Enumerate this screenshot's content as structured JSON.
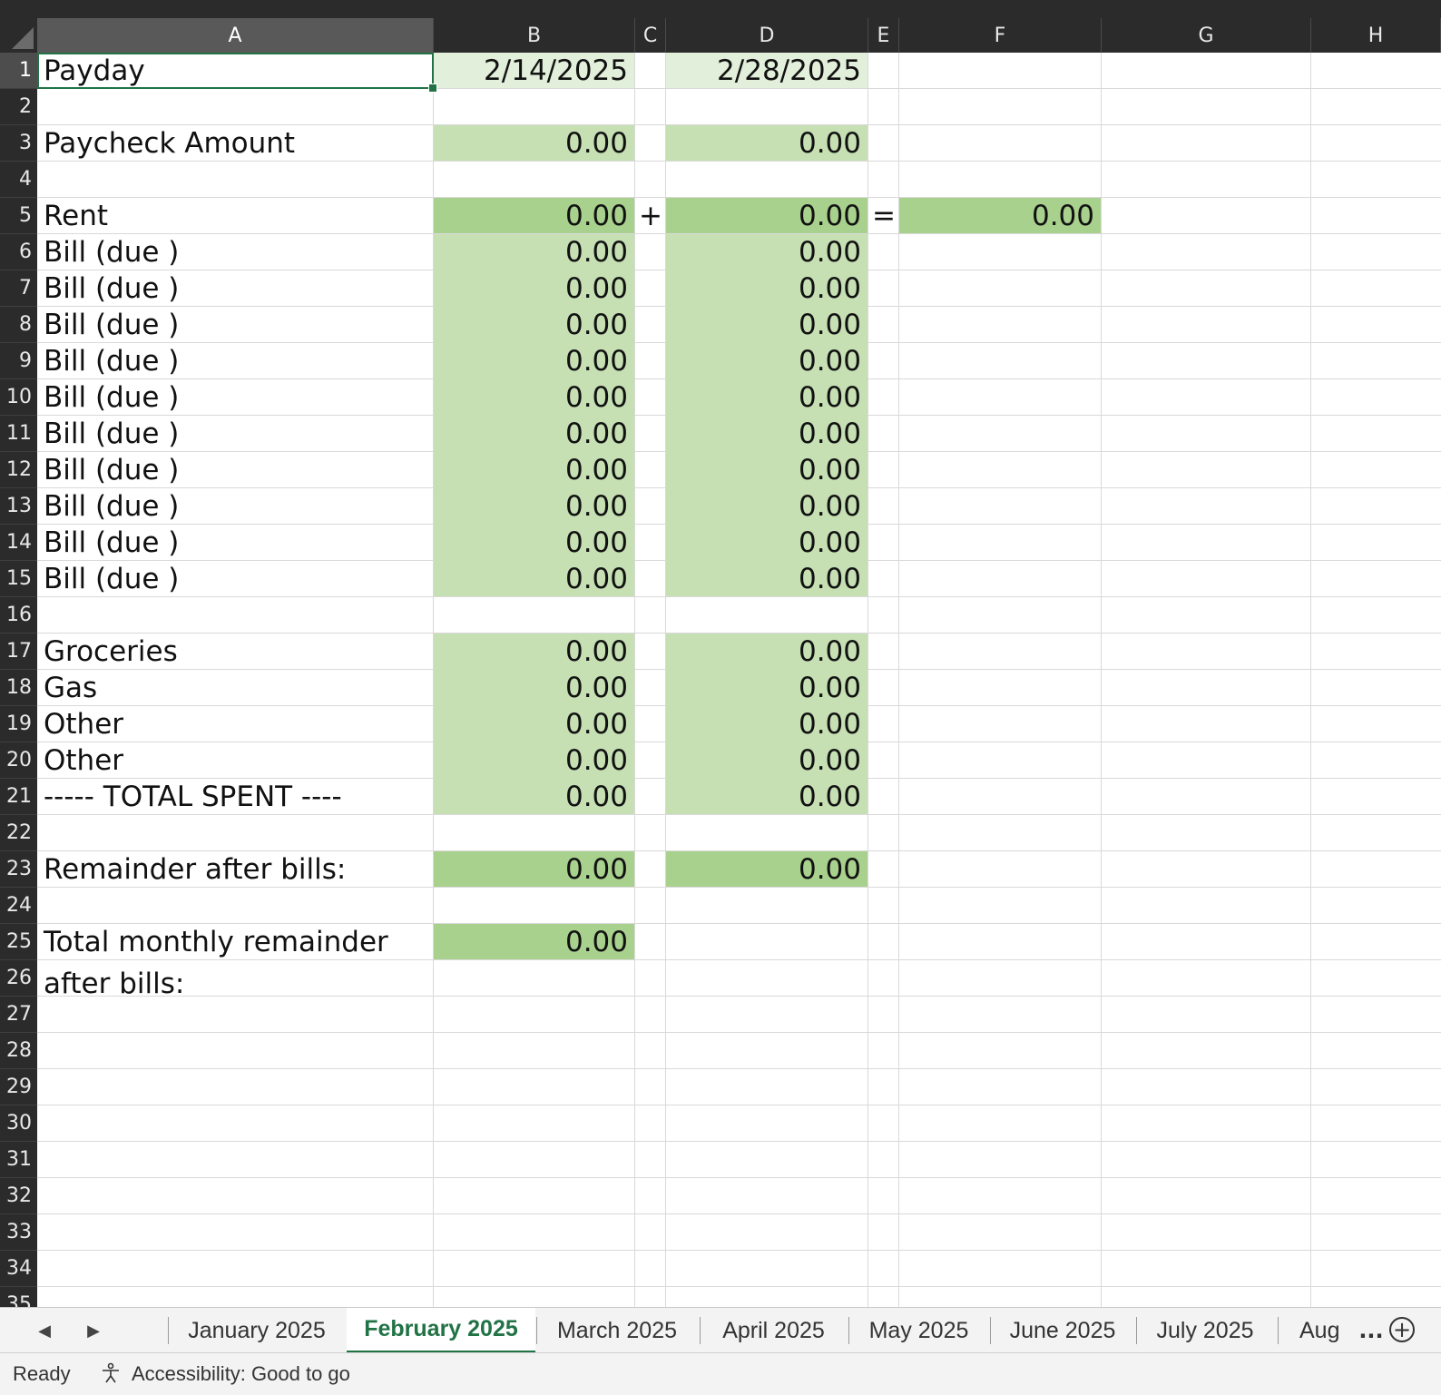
{
  "columns": [
    "A",
    "B",
    "C",
    "D",
    "E",
    "F",
    "G",
    "H"
  ],
  "row_numbers": [
    "1",
    "2",
    "3",
    "4",
    "5",
    "6",
    "7",
    "8",
    "9",
    "10",
    "11",
    "12",
    "13",
    "14",
    "15",
    "16",
    "17",
    "18",
    "19",
    "20",
    "21",
    "22",
    "23",
    "24",
    "25",
    "26",
    "27",
    "28",
    "29",
    "30",
    "31",
    "32",
    "33",
    "34",
    "35"
  ],
  "sheet": {
    "a1": "Payday",
    "a3": "Paycheck Amount",
    "a5": "Rent",
    "a6": "Bill (due )",
    "a7": "Bill (due )",
    "a8": "Bill (due )",
    "a9": "Bill (due )",
    "a10": "Bill (due )",
    "a11": "Bill (due )",
    "a12": "Bill (due )",
    "a13": "Bill (due )",
    "a14": "Bill (due )",
    "a15": "Bill (due )",
    "a17": "Groceries",
    "a18": "Gas",
    "a19": "Other",
    "a20": "Other",
    "a21": "----- TOTAL SPENT ----",
    "a23": "Remainder after bills:",
    "a25": "Total monthly remainder",
    "a26": "after bills:",
    "b1": "2/14/2025",
    "d1": "2/28/2025",
    "b3": "0.00",
    "d3": "0.00",
    "b5": "0.00",
    "c5": "+",
    "d5": "0.00",
    "e5": "=",
    "f5": "0.00",
    "b6": "0.00",
    "d6": "0.00",
    "b7": "0.00",
    "d7": "0.00",
    "b8": "0.00",
    "d8": "0.00",
    "b9": "0.00",
    "d9": "0.00",
    "b10": "0.00",
    "d10": "0.00",
    "b11": "0.00",
    "d11": "0.00",
    "b12": "0.00",
    "d12": "0.00",
    "b13": "0.00",
    "d13": "0.00",
    "b14": "0.00",
    "d14": "0.00",
    "b15": "0.00",
    "d15": "0.00",
    "b17": "0.00",
    "d17": "0.00",
    "b18": "0.00",
    "d18": "0.00",
    "b19": "0.00",
    "d19": "0.00",
    "b20": "0.00",
    "d20": "0.00",
    "b21": "0.00",
    "d21": "0.00",
    "b23": "0.00",
    "d23": "0.00",
    "b25": "0.00"
  },
  "tabs": [
    "January 2025",
    "February 2025",
    "March 2025",
    "April 2025",
    "May 2025",
    "June 2025",
    "July 2025",
    "Aug"
  ],
  "active_tab": "February 2025",
  "more_tabs_label": "...",
  "add_sheet_label": "+",
  "nav": {
    "prev": "◀",
    "next": "▶"
  },
  "status": {
    "ready": "Ready",
    "accessibility": "Accessibility: Good to go"
  },
  "colors": {
    "accent": "#217346",
    "fill_light": "#c6e0b4",
    "fill_medium": "#a9d18e",
    "fill_pale": "#e2efda",
    "header_bg": "#2b2b2b"
  }
}
